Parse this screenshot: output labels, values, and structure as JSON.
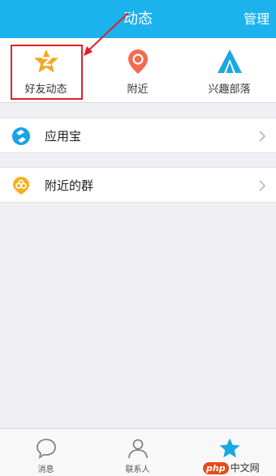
{
  "header": {
    "title": "动态",
    "right_action": "管理"
  },
  "quick_items": [
    {
      "label": "好友动态",
      "icon": "qzone-star-icon",
      "color": "#f5a623"
    },
    {
      "label": "附近",
      "icon": "location-pin-icon",
      "color": "#f26b4f"
    },
    {
      "label": "兴趣部落",
      "icon": "tent-icon",
      "color": "#1ba7e0"
    }
  ],
  "list": [
    {
      "label": "应用宝",
      "icon": "app-store-icon",
      "color": "#1aa3e8"
    },
    {
      "label": "附近的群",
      "icon": "nearby-group-icon",
      "color": "#f5b020"
    }
  ],
  "tabs": [
    {
      "label": "消息",
      "icon": "chat-bubble-icon"
    },
    {
      "label": "联系人",
      "icon": "contact-icon"
    },
    {
      "label": "",
      "icon": "star-icon",
      "active": true
    }
  ],
  "watermark": {
    "logo": "php",
    "text": "中文网"
  },
  "colors": {
    "header_bg": "#1bb2ee",
    "highlight": "#e0202a",
    "tab_active": "#1ba7e0"
  }
}
